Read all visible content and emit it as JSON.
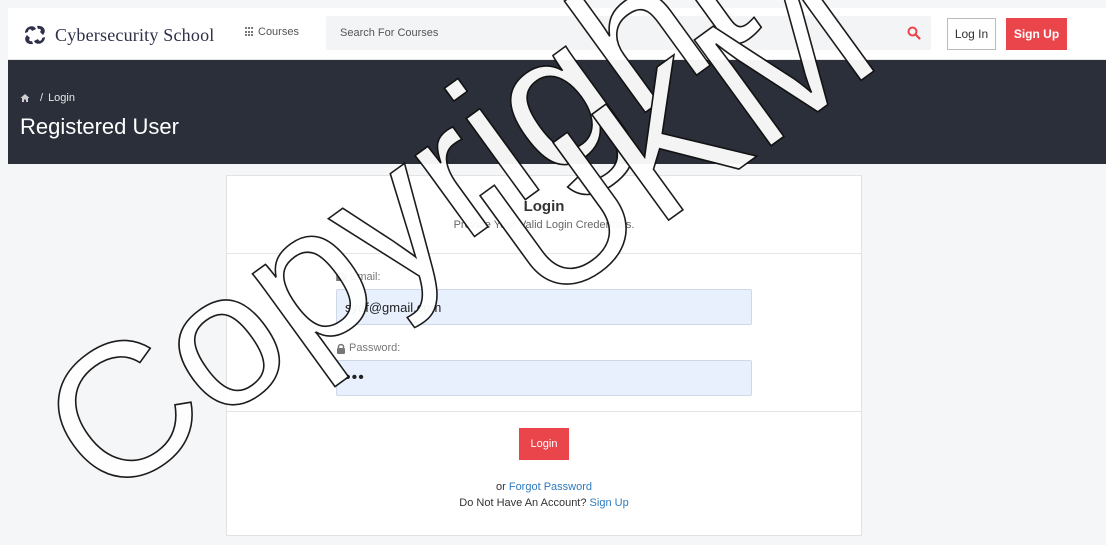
{
  "header": {
    "brand_name": "Cybersecurity School",
    "courses_label": "Courses",
    "search_placeholder": "Search For Courses",
    "login_label": "Log In",
    "signup_label": "Sign Up"
  },
  "hero": {
    "breadcrumb_current": "Login",
    "breadcrumb_separator": "/",
    "title": "Registered User"
  },
  "card": {
    "title": "Login",
    "subtitle": "Provide Your Valid Login Credentials.",
    "email_label": "Email:",
    "email_value": "syaf@gmail.com",
    "password_label": "Password:",
    "password_value": "•••",
    "submit_label": "Login",
    "or_text": "or",
    "forgot_link": "Forgot Password",
    "no_account_text": "Do Not Have An Account?",
    "signup_link": "Sign Up"
  },
  "watermark": {
    "line1": "Copyright ©",
    "line2": "UKM"
  },
  "colors": {
    "accent": "#e9454b",
    "hero_bg": "#2b2f3a",
    "link": "#2f7bbf",
    "field_bg": "#e8f0fe"
  },
  "icons": [
    "logo-icon",
    "grid-icon",
    "search-icon",
    "home-icon",
    "envelope-icon",
    "lock-icon"
  ]
}
